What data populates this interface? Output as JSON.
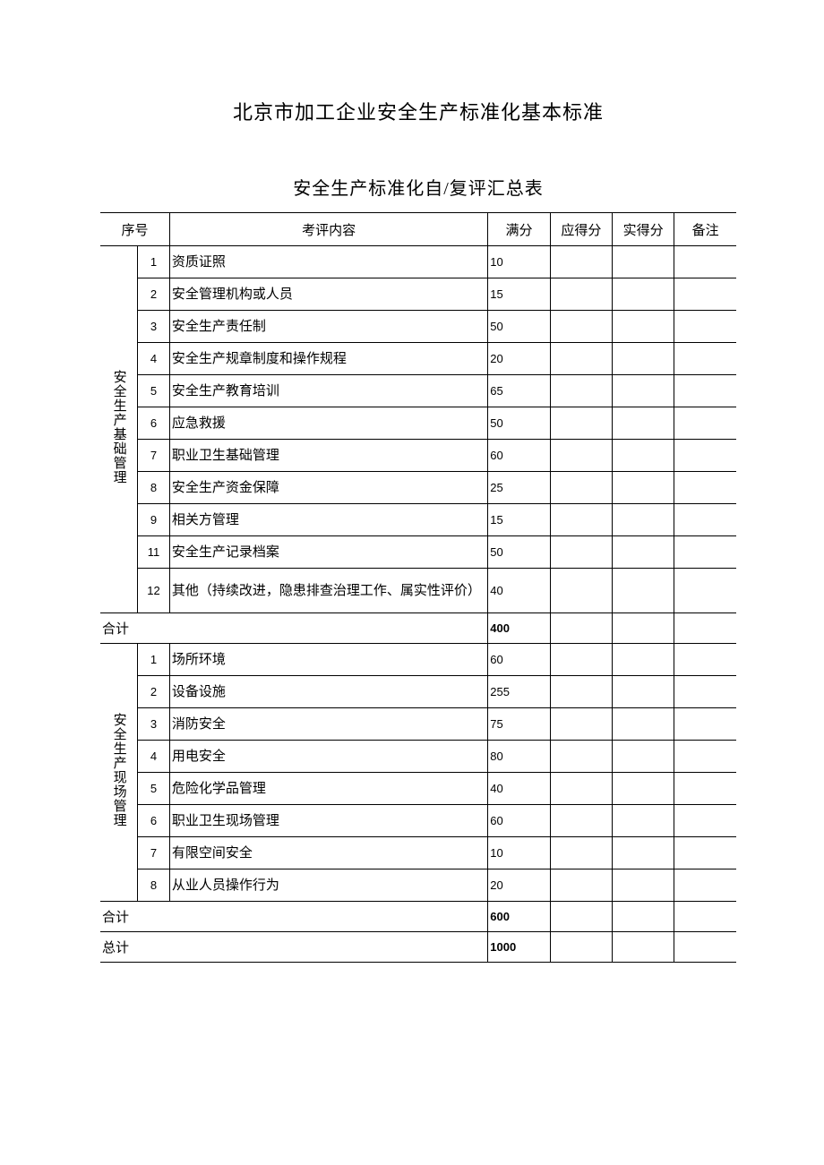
{
  "main_title": "北京市加工企业安全生产标准化基本标准",
  "sub_title": "安全生产标准化自/复评汇总表",
  "headers": {
    "seq": "序号",
    "content": "考评内容",
    "full": "满分",
    "due": "应得分",
    "got": "实得分",
    "note": "备注"
  },
  "sections": [
    {
      "group_label": "安全生产基础管理",
      "rows": [
        {
          "n": "1",
          "text": "资质证照",
          "full": "10"
        },
        {
          "n": "2",
          "text": "安全管理机构或人员",
          "full": "15"
        },
        {
          "n": "3",
          "text": "安全生产责任制",
          "full": "50"
        },
        {
          "n": "4",
          "text": "安全生产规章制度和操作规程",
          "full": "20"
        },
        {
          "n": "5",
          "text": "安全生产教育培训",
          "full": "65"
        },
        {
          "n": "6",
          "text": "应急救援",
          "full": "50"
        },
        {
          "n": "7",
          "text": "职业卫生基础管理",
          "full": "60"
        },
        {
          "n": "8",
          "text": "安全生产资金保障",
          "full": "25"
        },
        {
          "n": "9",
          "text": "相关方管理",
          "full": "15"
        },
        {
          "n": "11",
          "text": "安全生产记录档案",
          "full": "50"
        },
        {
          "n": "12",
          "text": "其他（持续改进，隐患排查治理工作、属实性评价）",
          "full": "40",
          "tall": true
        }
      ],
      "subtotal_label": "合计",
      "subtotal_full": "400"
    },
    {
      "group_label": "安全生产现场管理",
      "rows": [
        {
          "n": "1",
          "text": "场所环境",
          "full": "60"
        },
        {
          "n": "2",
          "text": "设备设施",
          "full": "255"
        },
        {
          "n": "3",
          "text": "消防安全",
          "full": "75"
        },
        {
          "n": "4",
          "text": "用电安全",
          "full": "80"
        },
        {
          "n": "5",
          "text": "危险化学品管理",
          "full": "40"
        },
        {
          "n": "6",
          "text": "职业卫生现场管理",
          "full": "60"
        },
        {
          "n": "7",
          "text": "有限空间安全",
          "full": "10"
        },
        {
          "n": "8",
          "text": "从业人员操作行为",
          "full": "20"
        }
      ],
      "subtotal_label": "合计",
      "subtotal_full": "600"
    }
  ],
  "total_label": "总计",
  "total_full": "1000"
}
